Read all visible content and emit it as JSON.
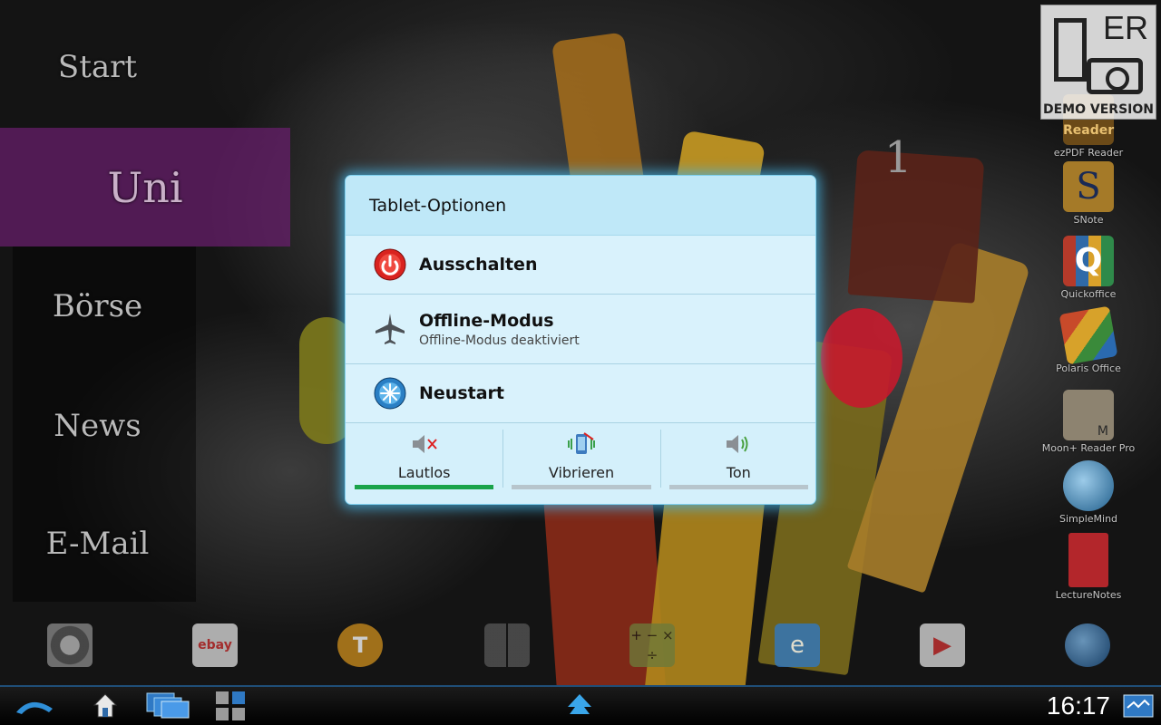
{
  "left_menu": {
    "items": [
      "Start",
      "Uni",
      "Börse",
      "News",
      "E-Mail"
    ],
    "active_index": 1
  },
  "demo_badge": {
    "logo_text": "ER",
    "label": "DEMO VERSION"
  },
  "page_indicator": "1",
  "right_apps": [
    {
      "label": "ezPDF Reader",
      "icon_text": "Reader",
      "icon": "ezpdf-reader-icon"
    },
    {
      "label": "SNote",
      "icon_text": "S",
      "icon": "snote-icon"
    },
    {
      "label": "Quickoffice",
      "icon_text": "Q",
      "icon": "quickoffice-icon"
    },
    {
      "label": "Polaris Office",
      "icon_text": "",
      "icon": "polaris-office-icon"
    },
    {
      "label": "Moon+ Reader Pro",
      "icon_text": "M",
      "icon": "moon-reader-icon"
    },
    {
      "label": "SimpleMind",
      "icon_text": "",
      "icon": "simplemind-icon"
    },
    {
      "label": "LectureNotes",
      "icon_text": "",
      "icon": "lecturenotes-icon"
    }
  ],
  "dock": [
    {
      "icon": "settings-icon"
    },
    {
      "icon": "ebay-icon",
      "icon_text": "ebay"
    },
    {
      "icon": "tapatalk-icon",
      "icon_text": "T"
    },
    {
      "icon": "app-folder-icon"
    },
    {
      "icon": "calculator-icon",
      "icon_text": "+ −  × ÷"
    },
    {
      "icon": "file-explorer-icon"
    },
    {
      "icon": "play-store-icon"
    },
    {
      "icon": "browser-icon"
    }
  ],
  "dialog": {
    "title": "Tablet-Optionen",
    "options": [
      {
        "label": "Ausschalten",
        "sublabel": "",
        "icon": "power-icon"
      },
      {
        "label": "Offline-Modus",
        "sublabel": "Offline-Modus deaktiviert",
        "icon": "airplane-icon"
      },
      {
        "label": "Neustart",
        "sublabel": "",
        "icon": "restart-icon"
      }
    ],
    "sound_modes": [
      {
        "label": "Lautlos",
        "icon": "mute-icon",
        "selected": true
      },
      {
        "label": "Vibrieren",
        "icon": "vibrate-icon",
        "selected": false
      },
      {
        "label": "Ton",
        "icon": "sound-on-icon",
        "selected": false
      }
    ]
  },
  "status_bar": {
    "time": "16:17",
    "nav_icons": [
      "back-icon",
      "home-icon",
      "recent-apps-icon",
      "app-drawer-icon",
      "menu-up-icon",
      "screenshot-icon"
    ]
  },
  "colors": {
    "dialog_bg": "#d4f0fb",
    "dialog_glow": "#46b4e6",
    "active_menu": "#691e6e",
    "selected_bar": "#1aa34a"
  }
}
